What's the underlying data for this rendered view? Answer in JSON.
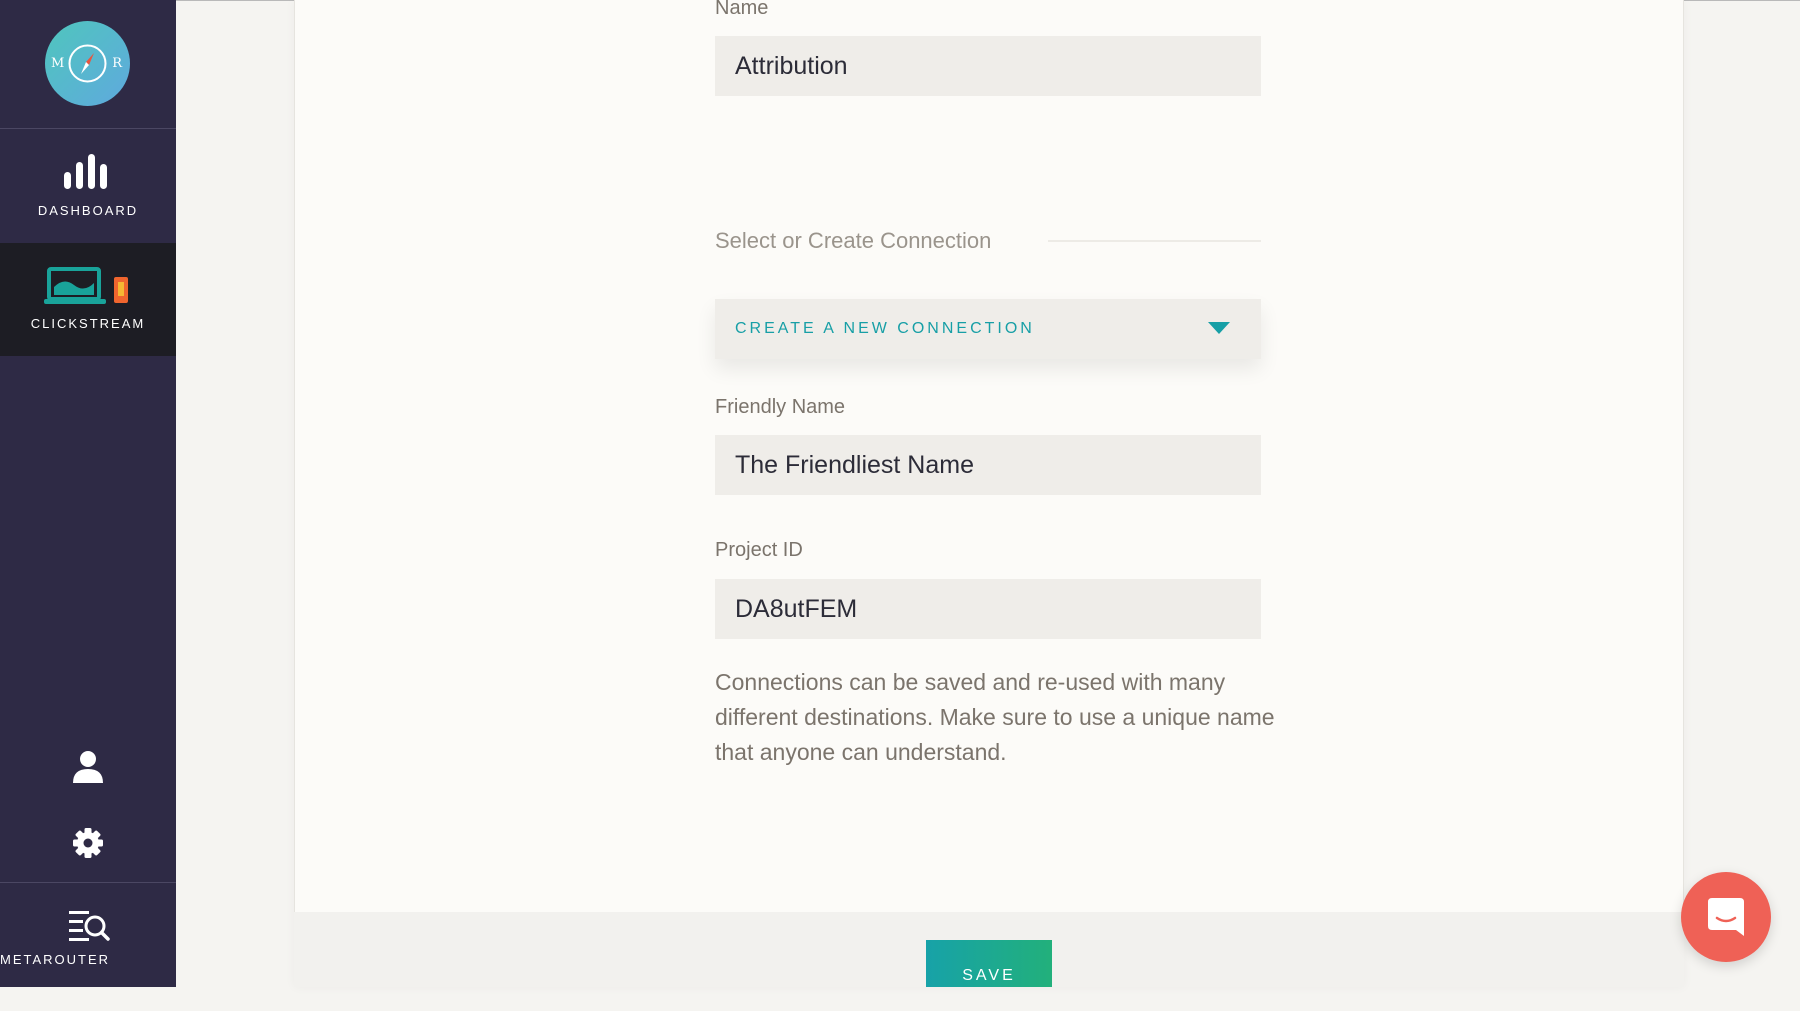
{
  "sidebar": {
    "logo": {
      "left_letter": "M",
      "right_letter": "R",
      "icon": "compass-logo"
    },
    "items": [
      {
        "label": "DASHBOARD",
        "icon": "bar-chart-icon",
        "active": false
      },
      {
        "label": "CLICKSTREAM",
        "icon": "laptop-phone-icon",
        "active": true
      }
    ],
    "bottom_icons": [
      {
        "name": "user-icon"
      },
      {
        "name": "settings-icon"
      }
    ],
    "brand": {
      "label": "METAROUTER",
      "icon": "search-list-icon"
    }
  },
  "form": {
    "name": {
      "label": "Name",
      "value": "Attribution"
    },
    "connection_section_title": "Select or Create Connection",
    "connection_dropdown": {
      "value": "CREATE A NEW CONNECTION"
    },
    "friendly_name": {
      "label": "Friendly Name",
      "value": "The Friendliest Name"
    },
    "project_id": {
      "label": "Project ID",
      "value": "DA8utFEM"
    },
    "help_text": "Connections can be saved and re-used with many different destinations. Make sure to use a unique name that anyone can understand.",
    "save_label": "SAVE"
  },
  "colors": {
    "sidebar_bg": "#2e2a45",
    "active_nav_bg": "#1d1d24",
    "accent_teal": "#179fa6",
    "accent_green": "#22b07b",
    "chat_red": "#ef6156"
  },
  "chat": {
    "icon": "chat-icon"
  }
}
